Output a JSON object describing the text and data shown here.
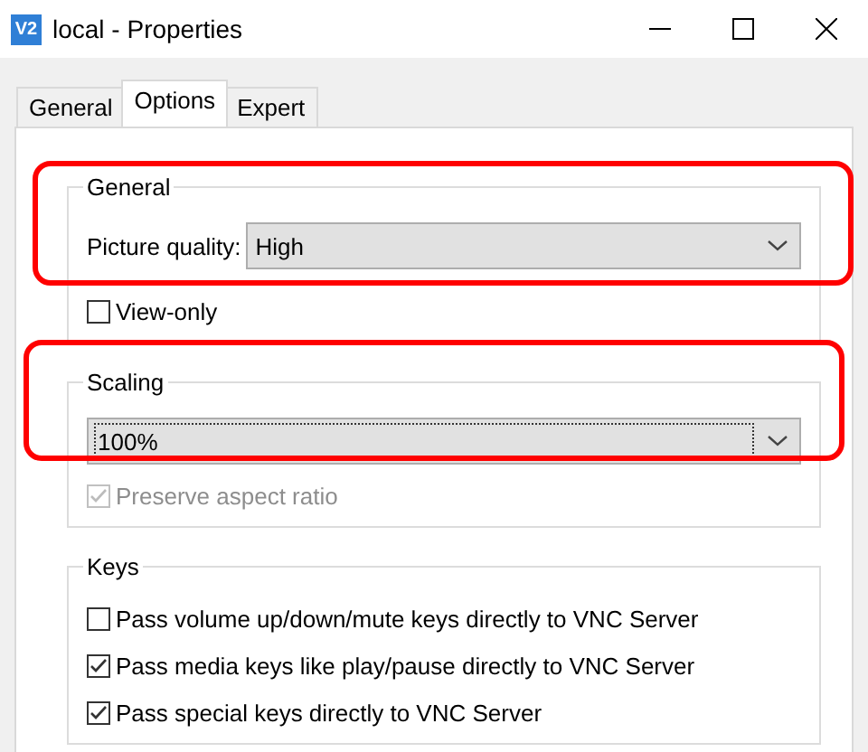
{
  "window": {
    "icon_text": "V2",
    "title": "local - Properties"
  },
  "tabs": [
    {
      "label": "General",
      "selected": false
    },
    {
      "label": "Options",
      "selected": true
    },
    {
      "label": "Expert",
      "selected": false
    }
  ],
  "general": {
    "title": "General",
    "highlighted": true,
    "picture_quality": {
      "label": "Picture quality:",
      "value": "High"
    },
    "view_only": {
      "label": "View-only",
      "checked": false,
      "disabled": false
    }
  },
  "scaling": {
    "title": "Scaling",
    "highlighted": true,
    "value": "100%",
    "preserve_aspect": {
      "label": "Preserve aspect ratio",
      "checked": true,
      "disabled": true
    }
  },
  "keys": {
    "title": "Keys",
    "options": [
      {
        "label": "Pass volume up/down/mute keys directly to VNC Server",
        "checked": false,
        "disabled": false
      },
      {
        "label": "Pass media keys like play/pause directly to VNC Server",
        "checked": true,
        "disabled": false
      },
      {
        "label": "Pass special keys directly to VNC Server",
        "checked": true,
        "disabled": false
      }
    ]
  }
}
